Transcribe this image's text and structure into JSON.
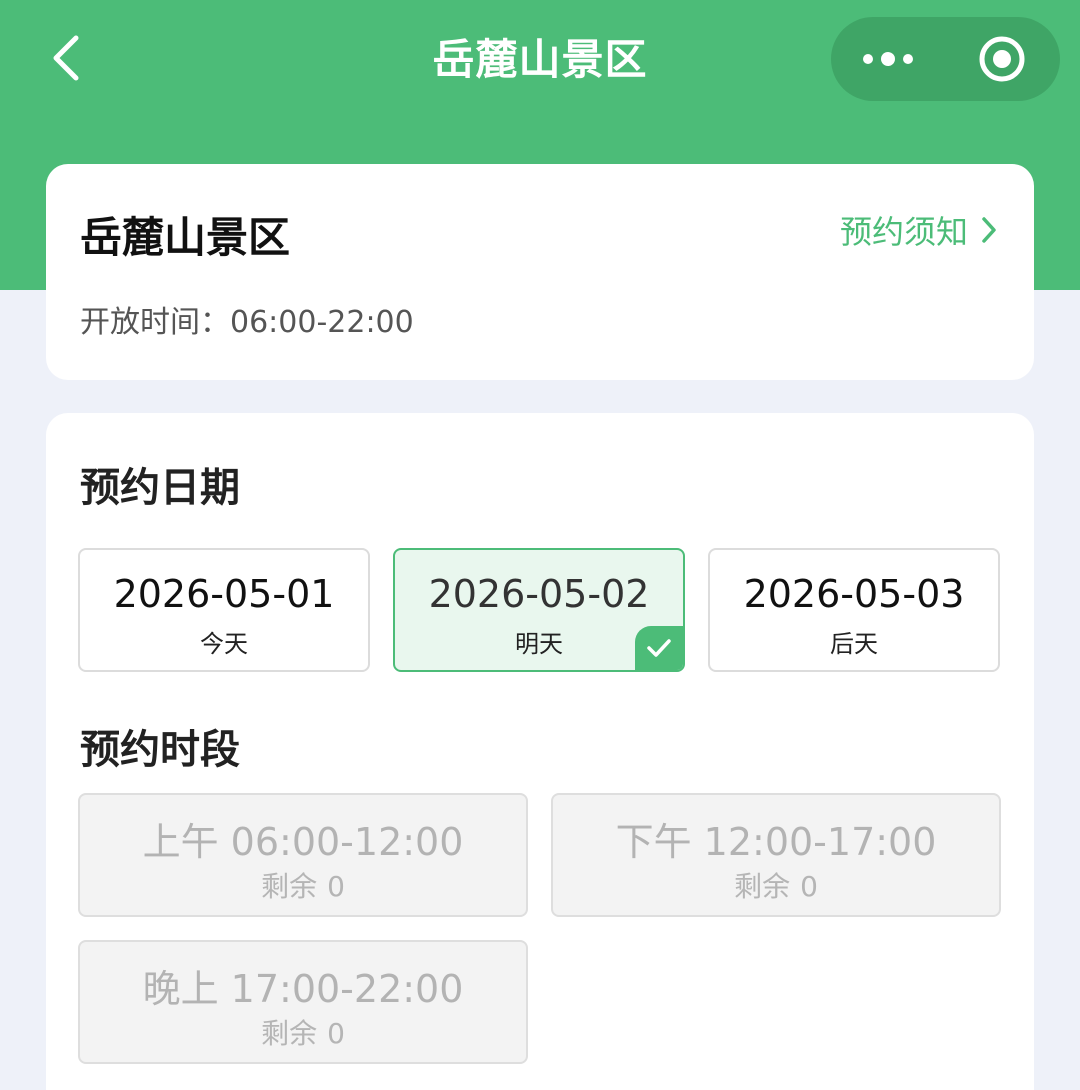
{
  "nav": {
    "title": "岳麓山景区",
    "back_icon": "chevron-left-icon",
    "more_icon": "more-dots-icon",
    "close_icon": "target-circle-icon"
  },
  "spot": {
    "name": "岳麓山景区",
    "notice_label": "预约须知",
    "open_time_label": "开放时间：",
    "open_time_value": "06:00-22:00"
  },
  "booking": {
    "date_section_title": "预约日期",
    "dates": [
      {
        "date": "2026-05-01",
        "label": "今天",
        "selected": false
      },
      {
        "date": "2026-05-02",
        "label": "明天",
        "selected": true
      },
      {
        "date": "2026-05-03",
        "label": "后天",
        "selected": false
      }
    ],
    "slot_section_title": "预约时段",
    "slots": [
      {
        "label": "上午 06:00-12:00",
        "remain_label": "剩余",
        "remain": "0"
      },
      {
        "label": "下午 12:00-17:00",
        "remain_label": "剩余",
        "remain": "0"
      },
      {
        "label": "晚上 17:00-22:00",
        "remain_label": "剩余",
        "remain": "0"
      }
    ]
  },
  "colors": {
    "brand_green": "#4cbc78",
    "capsule_green": "#3fa566",
    "page_bg": "#eef1f9"
  }
}
